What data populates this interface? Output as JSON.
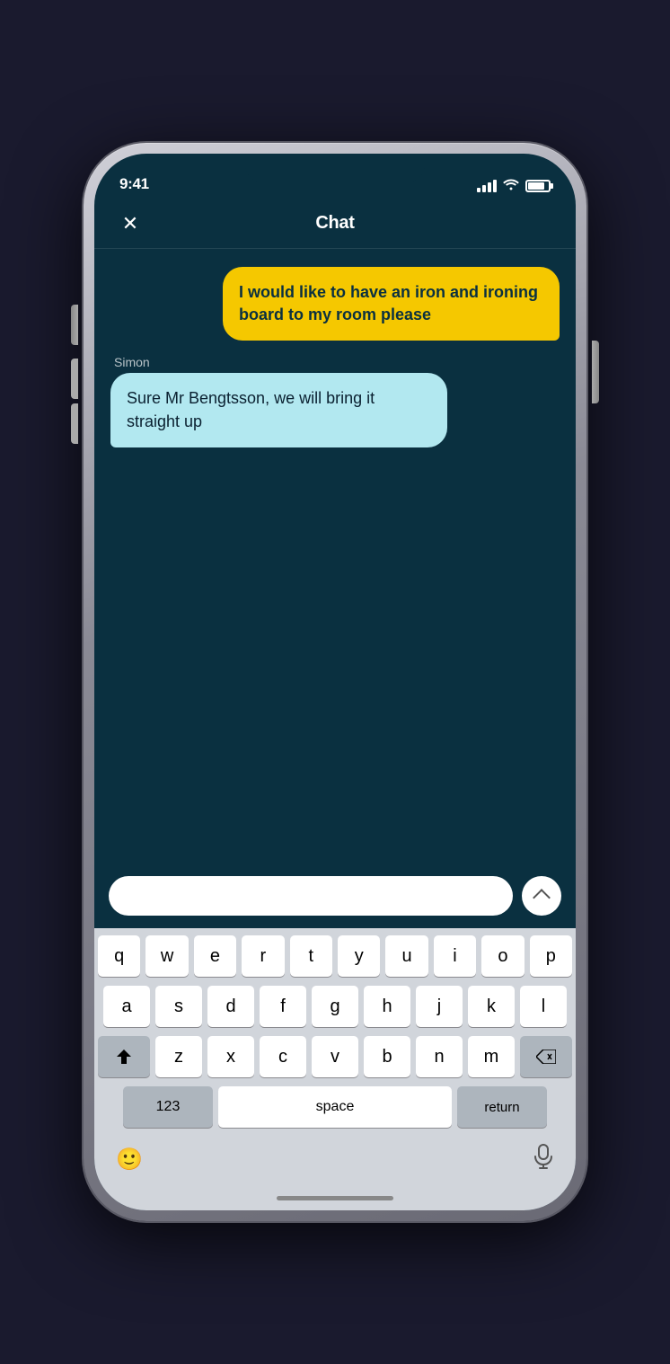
{
  "status_bar": {
    "time": "9:41"
  },
  "header": {
    "title": "Chat",
    "close_label": "×"
  },
  "messages": [
    {
      "id": "msg1",
      "type": "outgoing",
      "text": "I would like to have an iron and ironing board to my room please"
    },
    {
      "id": "msg2",
      "type": "incoming",
      "sender": "Simon",
      "text": "Sure Mr Bengtsson, we will bring it straight up"
    }
  ],
  "input": {
    "placeholder": "",
    "value": ""
  },
  "keyboard": {
    "row1": [
      "q",
      "w",
      "e",
      "r",
      "t",
      "y",
      "u",
      "i",
      "o",
      "p"
    ],
    "row2": [
      "a",
      "s",
      "d",
      "f",
      "g",
      "h",
      "j",
      "k",
      "l"
    ],
    "row3": [
      "z",
      "x",
      "c",
      "v",
      "b",
      "n",
      "m"
    ],
    "bottom": {
      "numbers_label": "123",
      "space_label": "space",
      "return_label": "return"
    }
  },
  "colors": {
    "background": "#0a3040",
    "bubble_outgoing": "#f5c800",
    "bubble_incoming": "#b2e8f0",
    "text_outgoing": "#0a3040",
    "text_incoming": "#0a2030"
  }
}
